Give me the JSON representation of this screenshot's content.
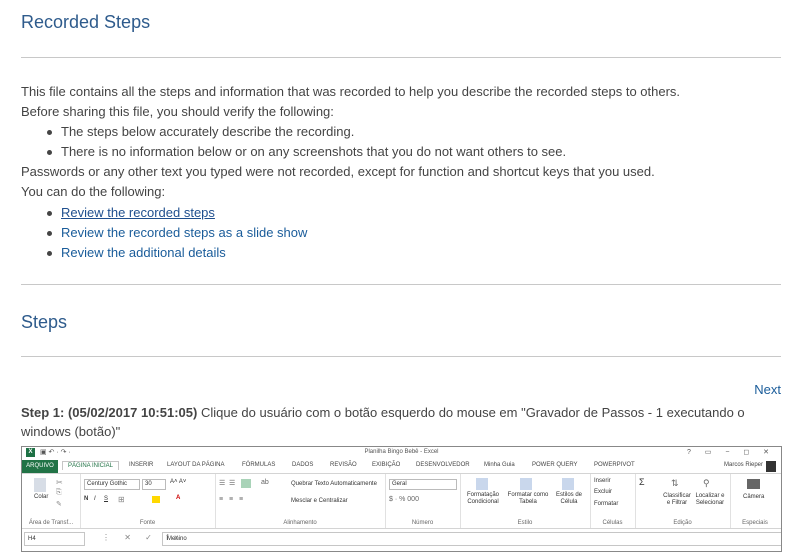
{
  "header": {
    "title": "Recorded Steps"
  },
  "intro": {
    "line1": "This file contains all the steps and information that was recorded to help you describe the recorded steps to others.",
    "line2": "Before sharing this file, you should verify the following:",
    "checks": [
      "The steps below accurately describe the recording.",
      "There is no information below or on any screenshots that you do not want others to see."
    ],
    "line3": "Passwords or any other text you typed were not recorded, except for function and shortcut keys that you used.",
    "line4": "You can do the following:",
    "links": [
      "Review the recorded steps",
      "Review the recorded steps as a slide show",
      "Review the additional details"
    ]
  },
  "steps_section": {
    "title": "Steps",
    "next": "Next"
  },
  "step1": {
    "label": "Step 1: (05/02/2017 10:51:05)",
    "text": " Clique do usuário com o botão esquerdo do mouse em \"Gravador de Passos - 1 executando o windows (botão)\""
  },
  "excel": {
    "window_title": "Planilha Bingo Bebê - Excel",
    "window_controls": "? ▭ − ◻ ✕",
    "qat": "▣ ↶ · ↷ ·",
    "logo": "X",
    "tabs": {
      "file": "ARQUIVO",
      "home": "PÁGINA INICIAL",
      "insert": "INSERIR",
      "layout": "LAYOUT DA PÁGINA",
      "formulas": "FÓRMULAS",
      "data": "DADOS",
      "review": "REVISÃO",
      "view": "EXIBIÇÃO",
      "developer": "DESENVOLVEDOR",
      "guide": "Minha Guia",
      "powerquery": "POWER QUERY",
      "powerpivot": "POWERPIVOT"
    },
    "user": "Marcos Rieper",
    "ribbon": {
      "paste": "Colar",
      "clipboard": "Área de Transf...",
      "font_name": "Century Gothic",
      "font_size": "30",
      "font_group": "Fonte",
      "wrap": "Quebrar Texto Automaticamente",
      "merge": "Mesclar e Centralizar",
      "align_group": "Alinhamento",
      "number_format": "Geral",
      "number_group": "Número",
      "cond_format": "Formatação Condicional",
      "format_table": "Formatar como Tabela",
      "cell_styles": "Estilos de Célula",
      "styles_group": "Estilo",
      "insert": "Inserir",
      "delete": "Excluir",
      "format": "Formatar",
      "cells_group": "Células",
      "sort": "Classificar e Filtrar",
      "find": "Localizar e Selecionar",
      "edit_group": "Edição",
      "camera": "Câmera",
      "special_group": "Especiais"
    },
    "name_box": "H4",
    "formula_icons": "⋮ ✕ ✓ fx",
    "formula_value": "Menino"
  }
}
